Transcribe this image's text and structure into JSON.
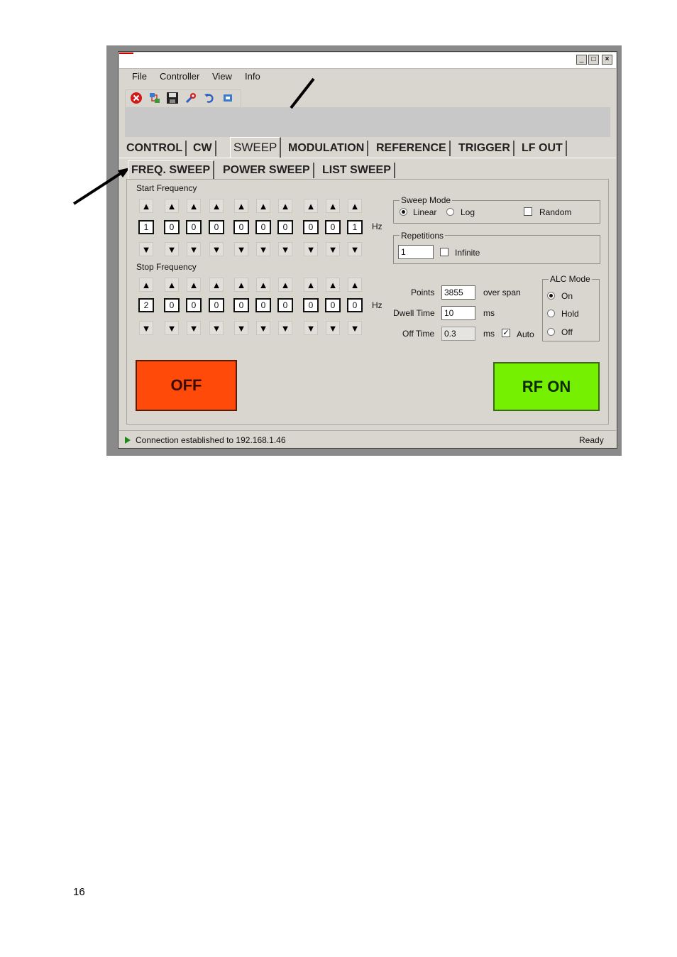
{
  "menu": [
    "File",
    "Controller",
    "View",
    "Info"
  ],
  "window_buttons": {
    "minimize": "_",
    "maximize": "□",
    "close": "×"
  },
  "toolbar_icons": [
    "stop-icon",
    "connect-icon",
    "save-icon",
    "settings-icon",
    "undo-icon",
    "window-icon"
  ],
  "main_tabs": [
    "CONTROL",
    "CW",
    "SWEEP",
    "MODULATION",
    "REFERENCE",
    "TRIGGER",
    "LF OUT"
  ],
  "sub_tabs": [
    "FREQ. SWEEP",
    "POWER SWEEP",
    "LIST SWEEP"
  ],
  "start_frequency": {
    "label": "Start Frequency",
    "digits": [
      "1",
      "0",
      "0",
      "0",
      "0",
      "0",
      "0",
      "0",
      "0",
      "1"
    ],
    "unit": "Hz"
  },
  "stop_frequency": {
    "label": "Stop Frequency",
    "digits": [
      "2",
      "0",
      "0",
      "0",
      "0",
      "0",
      "0",
      "0",
      "0",
      "0"
    ],
    "unit": "Hz"
  },
  "arrow_up": "▲",
  "arrow_down": "▼",
  "sweep_mode": {
    "title": "Sweep Mode",
    "linear": "Linear",
    "log": "Log",
    "random": "Random"
  },
  "repetitions": {
    "title": "Repetitions",
    "value": "1",
    "infinite": "Infinite"
  },
  "points": {
    "label": "Points",
    "value": "3855",
    "suffix": "over span"
  },
  "dwell_time": {
    "label": "Dwell Time",
    "value": "10",
    "unit": "ms"
  },
  "off_time": {
    "label": "Off Time",
    "value": "0.3",
    "unit": "ms",
    "auto": "Auto",
    "check_mark": "✓"
  },
  "alc_mode": {
    "title": "ALC Mode",
    "on": "On",
    "hold": "Hold",
    "off": "Off"
  },
  "buttons": {
    "off": "OFF",
    "rf_on": "RF ON"
  },
  "status": {
    "message": "Connection established to 192.168.1.46",
    "state": "Ready"
  },
  "page_number": "16"
}
